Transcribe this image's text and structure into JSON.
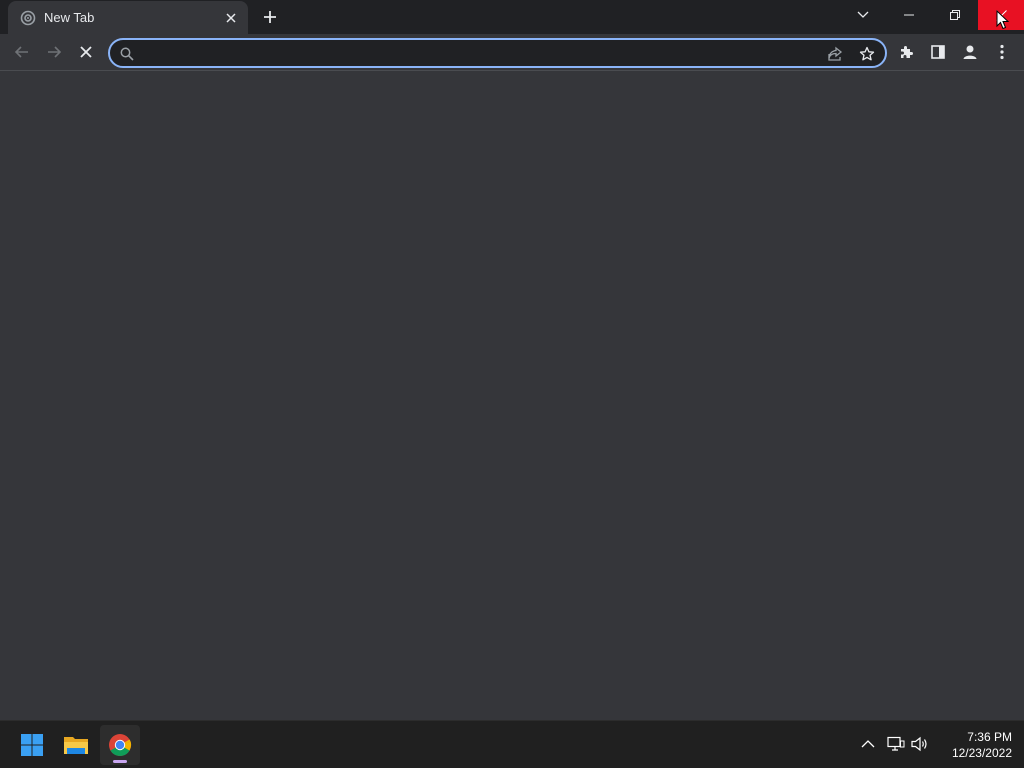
{
  "browser": {
    "tab": {
      "title": "New Tab",
      "favicon": "chrome-newtab-icon"
    },
    "new_tab_icon": "plus-icon",
    "tab_search_icon": "chevron-down-icon",
    "window_controls": [
      "minimize-icon",
      "restore-icon",
      "close-icon"
    ],
    "omnibox": {
      "value": "",
      "placeholder": ""
    },
    "colors": {
      "titlebar": "#202124",
      "toolbar": "#35363a",
      "omnibox_border": "#8ab4f8",
      "close_hover": "#e81123"
    }
  },
  "taskbar": {
    "apps": [
      "start-icon",
      "file-explorer-icon",
      "chrome-icon"
    ],
    "clock": {
      "time": "7:36 PM",
      "date": "12/23/2022"
    }
  }
}
